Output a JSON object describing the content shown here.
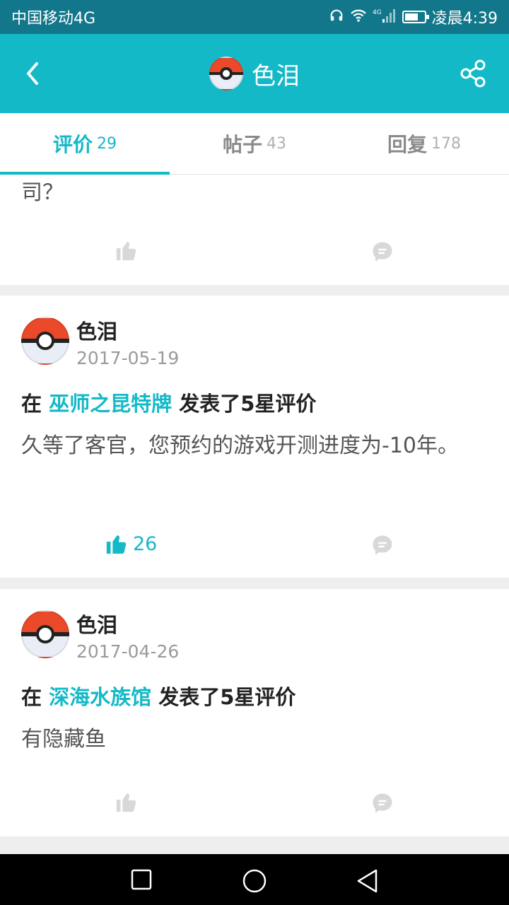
{
  "status_bar": {
    "carrier": "中国移动4G",
    "network": "4G",
    "time": "凌晨4:39"
  },
  "header": {
    "title": "色泪",
    "back_icon": "back-arrow-icon",
    "share_icon": "share-icon"
  },
  "tabs": [
    {
      "label": "评价",
      "count": "29",
      "active": true
    },
    {
      "label": "帖子",
      "count": "43",
      "active": false
    },
    {
      "label": "回复",
      "count": "178",
      "active": false
    }
  ],
  "feed": {
    "partial_card": {
      "text": "司？"
    },
    "cards": [
      {
        "author": "色泪",
        "date": "2017-05-19",
        "prefix": "在",
        "game": "巫师之昆特牌",
        "suffix": "发表了5星评价",
        "body": "久等了客官，您预约的游戏开测进度为-10年。",
        "likes": "26",
        "liked": true
      },
      {
        "author": "色泪",
        "date": "2017-04-26",
        "prefix": "在",
        "game": "深海水族馆",
        "suffix": "发表了5星评价",
        "body": "有隐藏鱼",
        "likes": "",
        "liked": false
      }
    ]
  },
  "colors": {
    "accent": "#14b9c8",
    "status_bar": "#12778a",
    "muted": "#cfcfcf"
  },
  "navbar": {
    "icons": [
      "recents-square-icon",
      "home-circle-icon",
      "back-triangle-icon"
    ]
  }
}
